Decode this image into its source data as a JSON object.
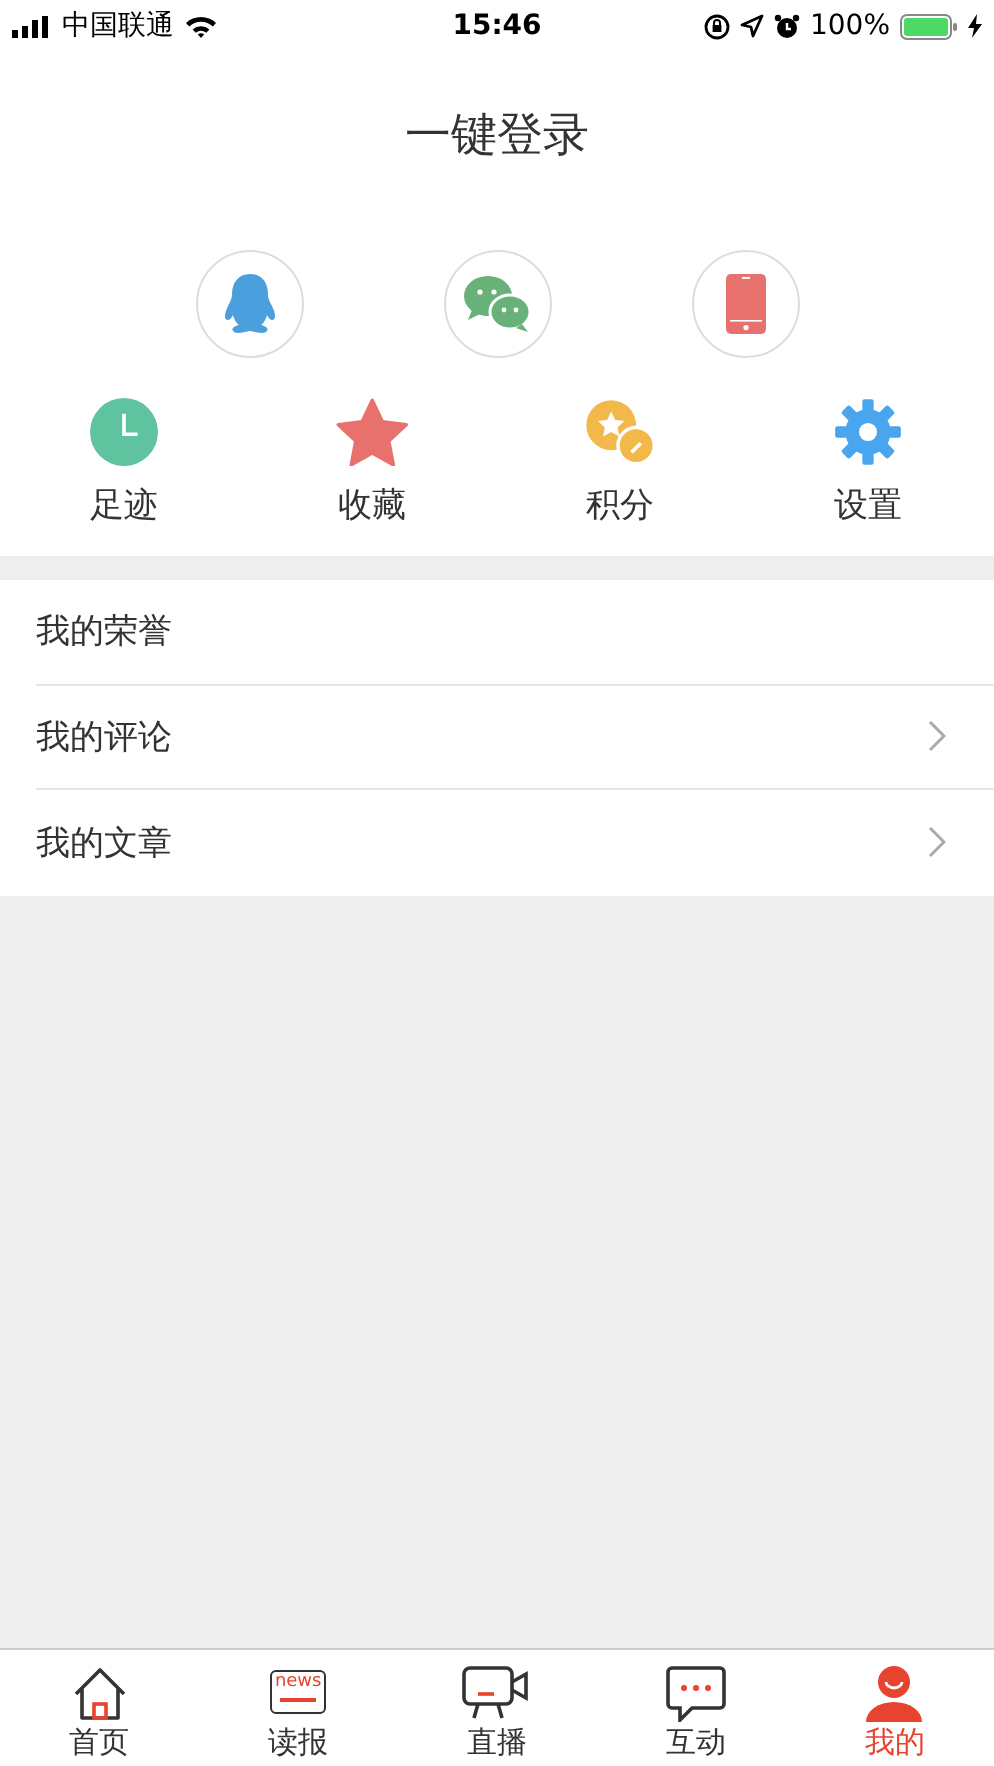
{
  "status_bar": {
    "carrier": "中国联通",
    "time": "15:46",
    "battery": "100%"
  },
  "title": "一键登录",
  "login_options": [
    {
      "kind": "qq"
    },
    {
      "kind": "wechat"
    },
    {
      "kind": "phone"
    }
  ],
  "shortcuts": [
    {
      "kind": "clock",
      "label": "足迹"
    },
    {
      "kind": "star",
      "label": "收藏"
    },
    {
      "kind": "points",
      "label": "积分"
    },
    {
      "kind": "gear",
      "label": "设置"
    }
  ],
  "menu": [
    {
      "label": "我的荣誉",
      "chevron": false
    },
    {
      "label": "我的评论",
      "chevron": true
    },
    {
      "label": "我的文章",
      "chevron": true
    }
  ],
  "tab_bar": [
    {
      "kind": "home",
      "label": "首页",
      "selected": false
    },
    {
      "kind": "news",
      "label": "读报",
      "icon_text": "news",
      "selected": false
    },
    {
      "kind": "video",
      "label": "直播",
      "selected": false
    },
    {
      "kind": "chat",
      "label": "互动",
      "selected": false
    },
    {
      "kind": "user",
      "label": "我的",
      "selected": true
    }
  ]
}
